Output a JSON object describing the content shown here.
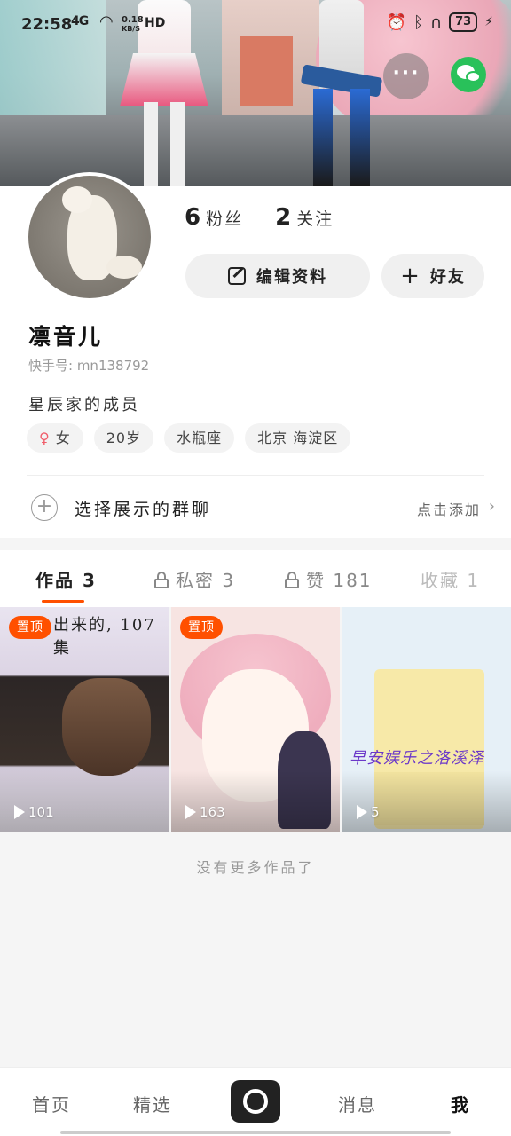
{
  "status_bar": {
    "time": "22:58",
    "signal": "4G",
    "speed_value": "0.18",
    "speed_unit": "KB/S",
    "hd": "HD",
    "battery": "73"
  },
  "profile": {
    "fans_count": "6",
    "fans_label": "粉丝",
    "following_count": "2",
    "following_label": "关注",
    "edit_label": "编辑资料",
    "friend_label": "好友",
    "nickname": "凛音儿",
    "kuaishou_id": "快手号: mn138792",
    "bio": "星辰家的成员",
    "tags": {
      "gender": "女",
      "age": "20岁",
      "zodiac": "水瓶座",
      "location": "北京 海淀区"
    },
    "group_label": "选择展示的群聊",
    "group_action": "点击添加"
  },
  "tabs": {
    "works": "作品 3",
    "private": "私密 3",
    "likes": "赞 181",
    "favorites": "收藏 1"
  },
  "videos": [
    {
      "pinned": "置顶",
      "plays": "101",
      "caption": "出来的, 107集"
    },
    {
      "pinned": "置顶",
      "plays": "163"
    },
    {
      "plays": "5",
      "brand": "早安娱乐之洛溪泽"
    }
  ],
  "no_more": "没有更多作品了",
  "bottom_nav": {
    "home": "首页",
    "featured": "精选",
    "messages": "消息",
    "me": "我"
  },
  "colors": {
    "accent": "#ff5000",
    "wechat": "#29c15a"
  }
}
